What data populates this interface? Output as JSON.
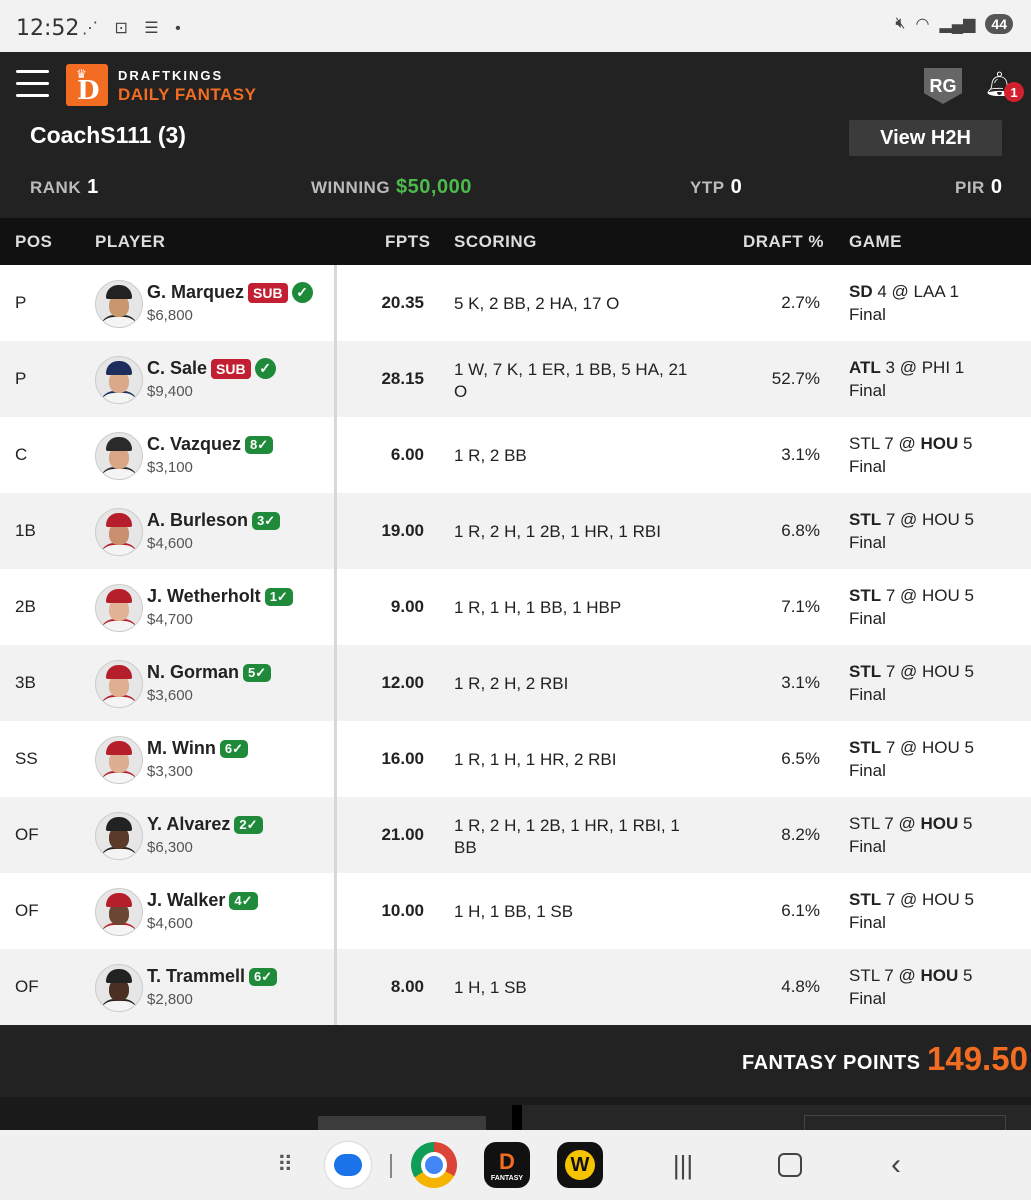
{
  "status_bar": {
    "time": "12:52",
    "left_icons": "⋰ ⊡ ☰ •",
    "battery": "44"
  },
  "header": {
    "brand_top": "DRAFTKINGS",
    "brand_bottom": "DAILY FANTASY",
    "rg": "RG",
    "bell_count": "1"
  },
  "summary": {
    "coach": "CoachS111 (3)",
    "view_h2h": "View H2H",
    "rank_label": "RANK",
    "rank": "1",
    "winning_label": "WINNING",
    "winning": "$50,000",
    "ytp_label": "YTP",
    "ytp": "0",
    "pir_label": "PIR",
    "pir": "0"
  },
  "columns": {
    "pos": "POS",
    "player": "PLAYER",
    "fpts": "FPTS",
    "scoring": "SCORING",
    "draft": "DRAFT %",
    "game": "GAME"
  },
  "players": [
    {
      "pos": "P",
      "name": "G. Marquez",
      "badge": "SUB",
      "salary": "$6,800",
      "fpts": "20.35",
      "scoring": "5 K, 2 BB, 2 HA, 17 O",
      "draft": "2.7%",
      "away": "SD",
      "away_score": "4",
      "home": "LAA",
      "home_score": "1",
      "bold": "away",
      "status": "Final",
      "cap": "#222",
      "skin": "#c9976e"
    },
    {
      "pos": "P",
      "name": "C. Sale",
      "badge": "SUB",
      "salary": "$9,400",
      "fpts": "28.15",
      "scoring": "1 W, 7 K, 1 ER, 1 BB, 5 HA, 21 O",
      "draft": "52.7%",
      "away": "ATL",
      "away_score": "3",
      "home": "PHI",
      "home_score": "1",
      "bold": "away",
      "status": "Final",
      "cap": "#1d2d5c",
      "skin": "#d9a98a"
    },
    {
      "pos": "C",
      "name": "C. Vazquez",
      "badge": "8",
      "salary": "$3,100",
      "fpts": "6.00",
      "scoring": "1 R, 2 BB",
      "draft": "3.1%",
      "away": "STL",
      "away_score": "7",
      "home": "HOU",
      "home_score": "5",
      "bold": "home",
      "status": "Final",
      "cap": "#2a2a2a",
      "skin": "#d8a585"
    },
    {
      "pos": "1B",
      "name": "A. Burleson",
      "badge": "3",
      "salary": "$4,600",
      "fpts": "19.00",
      "scoring": "1 R, 2 H, 1 2B, 1 HR, 1 RBI",
      "draft": "6.8%",
      "away": "STL",
      "away_score": "7",
      "home": "HOU",
      "home_score": "5",
      "bold": "away",
      "status": "Final",
      "cap": "#b41f2b",
      "skin": "#c98f6f"
    },
    {
      "pos": "2B",
      "name": "J. Wetherholt",
      "badge": "1",
      "salary": "$4,700",
      "fpts": "9.00",
      "scoring": "1 R, 1 H, 1 BB, 1 HBP",
      "draft": "7.1%",
      "away": "STL",
      "away_score": "7",
      "home": "HOU",
      "home_score": "5",
      "bold": "away",
      "status": "Final",
      "cap": "#b41f2b",
      "skin": "#e1b296"
    },
    {
      "pos": "3B",
      "name": "N. Gorman",
      "badge": "5",
      "salary": "$3,600",
      "fpts": "12.00",
      "scoring": "1 R, 2 H, 2 RBI",
      "draft": "3.1%",
      "away": "STL",
      "away_score": "7",
      "home": "HOU",
      "home_score": "5",
      "bold": "away",
      "status": "Final",
      "cap": "#b41f2b",
      "skin": "#e0ae90"
    },
    {
      "pos": "SS",
      "name": "M. Winn",
      "badge": "6",
      "salary": "$3,300",
      "fpts": "16.00",
      "scoring": "1 R, 1 H, 1 HR, 2 RBI",
      "draft": "6.5%",
      "away": "STL",
      "away_score": "7",
      "home": "HOU",
      "home_score": "5",
      "bold": "away",
      "status": "Final",
      "cap": "#b41f2b",
      "skin": "#dcae92"
    },
    {
      "pos": "OF",
      "name": "Y. Alvarez",
      "badge": "2",
      "salary": "$6,300",
      "fpts": "21.00",
      "scoring": "1 R, 2 H, 1 2B, 1 HR, 1 RBI, 1 BB",
      "draft": "8.2%",
      "away": "STL",
      "away_score": "7",
      "home": "HOU",
      "home_score": "5",
      "bold": "home",
      "status": "Final",
      "cap": "#222",
      "skin": "#5a3b2a"
    },
    {
      "pos": "OF",
      "name": "J. Walker",
      "badge": "4",
      "salary": "$4,600",
      "fpts": "10.00",
      "scoring": "1 H, 1 BB, 1 SB",
      "draft": "6.1%",
      "away": "STL",
      "away_score": "7",
      "home": "HOU",
      "home_score": "5",
      "bold": "away",
      "status": "Final",
      "cap": "#b41f2b",
      "skin": "#6b4632"
    },
    {
      "pos": "OF",
      "name": "T. Trammell",
      "badge": "6",
      "salary": "$2,800",
      "fpts": "8.00",
      "scoring": "1 H, 1 SB",
      "draft": "4.8%",
      "away": "STL",
      "away_score": "7",
      "home": "HOU",
      "home_score": "5",
      "bold": "home",
      "status": "Final",
      "cap": "#222",
      "skin": "#4a3022"
    }
  ],
  "footer": {
    "label": "FANTASY POINTS",
    "value": "149.50"
  },
  "dock": {
    "dk_label": "FANTASY",
    "w_label": "W"
  },
  "colors": {
    "brand_orange": "#f26d21",
    "winning_green": "#4cbb4c",
    "sub_red": "#c21f33",
    "check_green": "#1e8a3a"
  }
}
